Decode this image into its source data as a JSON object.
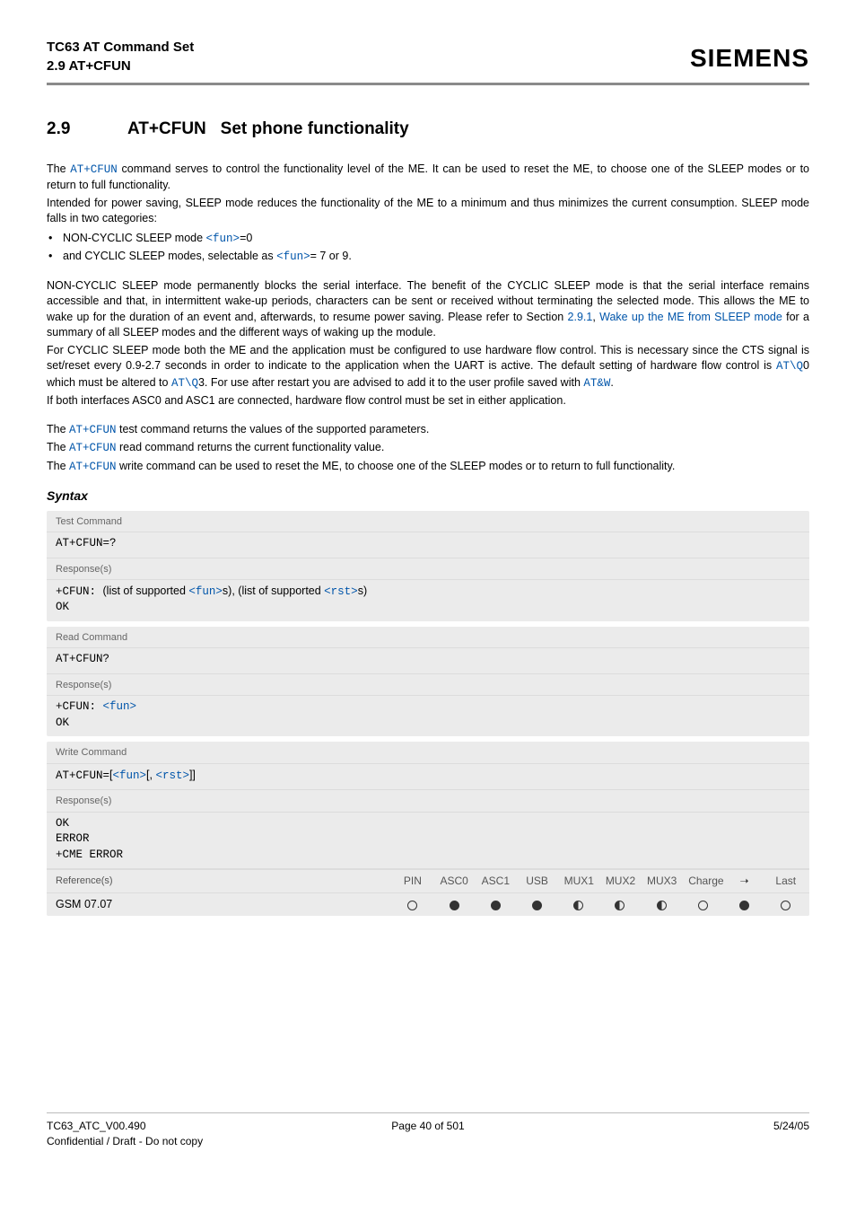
{
  "header": {
    "doc_title": "TC63 AT Command Set",
    "section_ref": "2.9 AT+CFUN",
    "brand": "SIEMENS"
  },
  "title": {
    "number": "2.9",
    "name": "AT+CFUN",
    "desc": "Set phone functionality"
  },
  "intro": {
    "p1a": "The ",
    "p1_cmd": "AT+CFUN",
    "p1b": " command serves to control the functionality level of the ME. It can be used to reset the ME, to choose one of the SLEEP modes or to return to full functionality.",
    "p2": "Intended for power saving, SLEEP mode reduces the functionality of the ME to a minimum and thus minimizes the current consumption. SLEEP mode falls in two categories:",
    "bul1a": "NON-CYCLIC SLEEP mode ",
    "bul1_fun": "<fun>",
    "bul1b": "=0",
    "bul2a": "and CYCLIC SLEEP modes, selectable as ",
    "bul2_fun": "<fun>",
    "bul2b": "= 7 or 9."
  },
  "body": {
    "p3a": "NON-CYCLIC SLEEP mode permanently blocks the serial interface. The benefit of the CYCLIC SLEEP mode is that the serial interface remains accessible and that, in intermittent wake-up periods, characters can be sent or received without terminating the selected mode. This allows the ME to wake up for the duration of an event and, afterwards, to resume power saving. Please refer to Section ",
    "p3_link1": "2.9.1",
    "p3b": ", ",
    "p3_link2": "Wake up the ME from SLEEP mode",
    "p3c": " for a summary of all SLEEP modes and the different ways of waking up the module.",
    "p4a": "For CYCLIC SLEEP mode both the ME and the application must be configured to use hardware flow control. This is necessary since the CTS signal is set/reset every 0.9-2.7 seconds in order to indicate to the application when the UART is active. The default setting of hardware flow control is ",
    "p4_cmd1": "AT\\Q",
    "p4b": "0 which must be altered to ",
    "p4_cmd2": "AT\\Q",
    "p4c": "3. For use after restart you are advised to add it to the user profile saved with ",
    "p4_cmd3": "AT&W",
    "p4d": ".",
    "p5": "If both interfaces ASC0 and ASC1 are connected, hardware flow control must be set in either application.",
    "p6a": "The ",
    "p6_cmd": "AT+CFUN",
    "p6b": " test command returns the values of the supported parameters.",
    "p7a": "The ",
    "p7_cmd": "AT+CFUN",
    "p7b": " read command returns the current functionality value.",
    "p8a": "The ",
    "p8_cmd": "AT+CFUN",
    "p8b": " write command can be used to reset the ME, to choose one of the SLEEP modes or to return to full functionality."
  },
  "syntax": {
    "heading": "Syntax",
    "test_label": "Test Command",
    "test_cmd": "AT+CFUN=?",
    "resp_label": "Response(s)",
    "test_resp_a": "+CFUN: ",
    "test_resp_b": "(list of supported ",
    "test_resp_fun": "<fun>",
    "test_resp_c": "s)",
    "test_resp_d": ", (list of supported ",
    "test_resp_rst": "<rst>",
    "test_resp_e": "s)",
    "ok": "OK",
    "read_label": "Read Command",
    "read_cmd": "AT+CFUN?",
    "read_resp_a": "+CFUN: ",
    "read_resp_fun": "<fun>",
    "write_label": "Write Command",
    "write_cmd_a": "AT+CFUN=",
    "write_cmd_b": "[",
    "write_cmd_fun": "<fun>",
    "write_cmd_c": "[, ",
    "write_cmd_rst": "<rst>",
    "write_cmd_d": "]]",
    "write_resp_err": "ERROR",
    "write_resp_cme": "+CME ERROR",
    "ref_label": "Reference(s)",
    "ref_value": "GSM 07.07",
    "cols": {
      "c1": "PIN",
      "c2": "ASC0",
      "c3": "ASC1",
      "c4": "USB",
      "c5": "MUX1",
      "c6": "MUX2",
      "c7": "MUX3",
      "c8": "Charge",
      "c9": "➝",
      "c10": "Last"
    }
  },
  "footer": {
    "left1": "TC63_ATC_V00.490",
    "left2": "Confidential / Draft - Do not copy",
    "center": "Page 40 of 501",
    "right": "5/24/05"
  }
}
